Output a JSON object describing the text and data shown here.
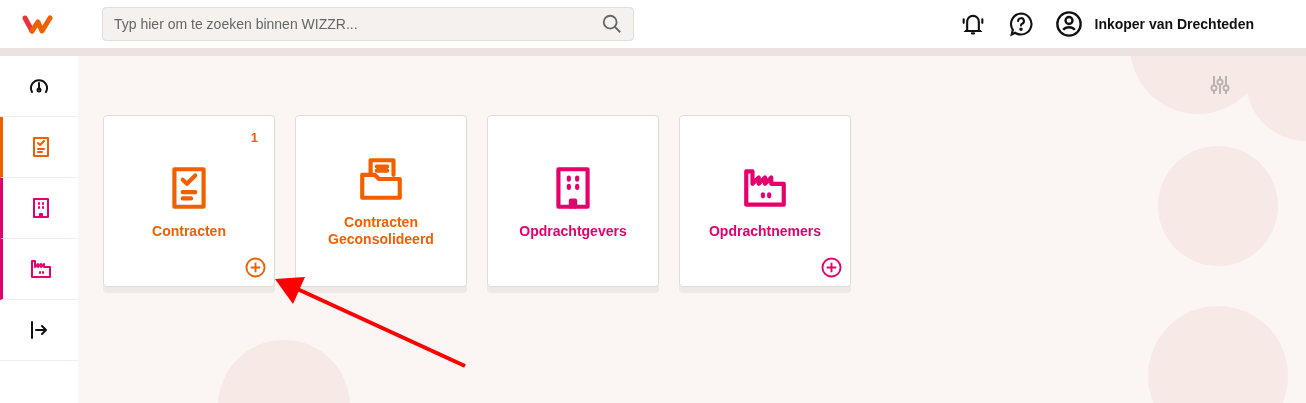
{
  "search": {
    "placeholder": "Typ hier om te zoeken binnen WIZZR..."
  },
  "user": {
    "name": "Inkoper van Drechteden"
  },
  "sidebar": {
    "items": [
      {
        "kind": "dashboard",
        "color": "#111111",
        "marked": false
      },
      {
        "kind": "contract",
        "color": "#f06000",
        "marked": true
      },
      {
        "kind": "building",
        "color": "#e6006e",
        "marked": true
      },
      {
        "kind": "factory",
        "color": "#e6006e",
        "marked": true
      },
      {
        "kind": "logout",
        "color": "#111111",
        "marked": false
      }
    ]
  },
  "tiles": [
    {
      "kind": "contract",
      "label": "Contracten",
      "color": "#f06000",
      "count": "1",
      "add": true
    },
    {
      "kind": "folder",
      "label": "Contracten Geconsolideerd",
      "color": "#f06000",
      "add": false
    },
    {
      "kind": "building",
      "label": "Opdrachtgevers",
      "color": "#e6006e",
      "add": false
    },
    {
      "kind": "factory",
      "label": "Opdrachtnemers",
      "color": "#e6006e",
      "add": true
    }
  ]
}
